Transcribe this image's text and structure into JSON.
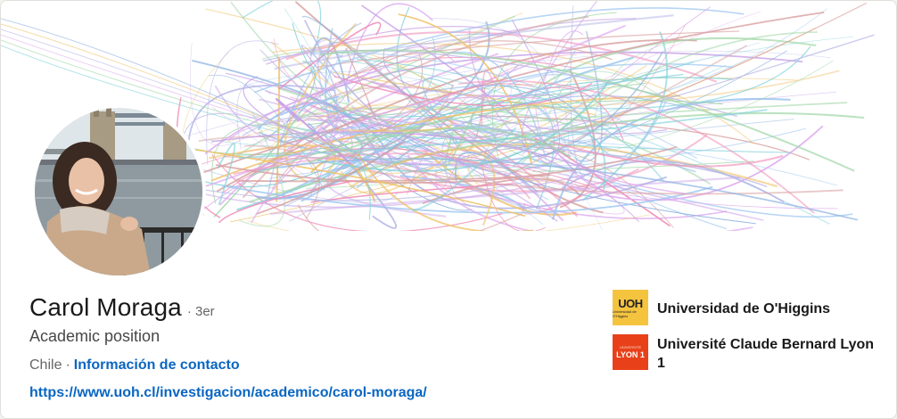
{
  "profile": {
    "name": "Carol Moraga",
    "degree": "· 3er",
    "headline": "Academic position",
    "location": "Chile",
    "separator": "·",
    "contact_link": "Información de contacto",
    "website": "https://www.uoh.cl/investigacion/academico/carol-moraga/"
  },
  "education": [
    {
      "name": "Universidad de O'Higgins",
      "logo_text": "UOH",
      "logo_sub": "Universidad de O'Higgins",
      "logo_color": "#f5c43f"
    },
    {
      "name": "Université Claude Bernard Lyon 1",
      "logo_text": "LYON 1",
      "logo_sub": "UNIVERSITÉ",
      "logo_color": "#e8411a"
    }
  ],
  "colors": {
    "link": "#0a66c2",
    "text_primary": "#191919",
    "text_secondary": "#666666"
  },
  "icons": {
    "banner": "abstract-line-art-banner",
    "avatar": "profile-photo"
  }
}
